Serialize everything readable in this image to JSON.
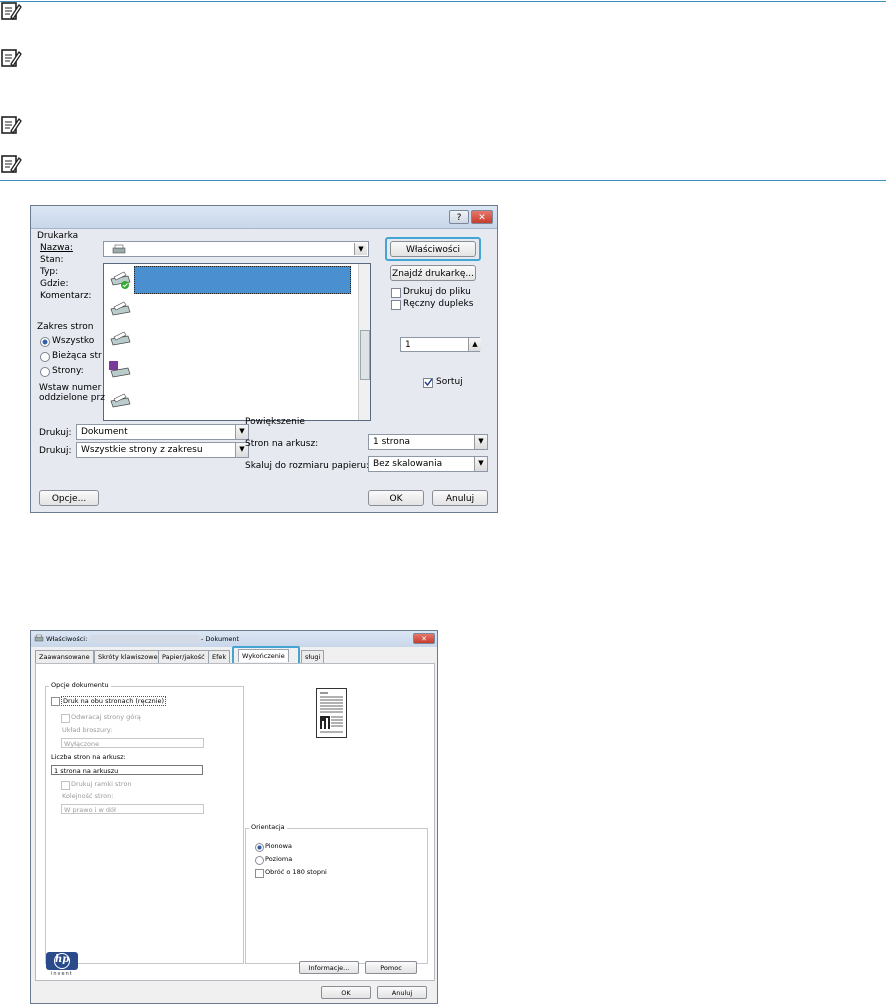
{
  "notes": {
    "count": 4
  },
  "print_dialog": {
    "help_glyph": "?",
    "close_glyph": "✕",
    "printer_group": "Drukarka",
    "name_label": "Nazwa:",
    "status_label": "Stan:",
    "type_label": "Typ:",
    "where_label": "Gdzie:",
    "comment_label": "Komentarz:",
    "properties_button": "Właściwości",
    "find_printer_button": "Znajdź drukarkę...",
    "print_to_file": "Drukuj do pliku",
    "manual_duplex": "Ręczny dupleks",
    "range_group": "Zakres stron",
    "range_all": "Wszystko",
    "range_current": "Bieżąca str",
    "range_pages": "Strony:",
    "insert_hint_1": "Wstaw numer",
    "insert_hint_2": "oddzielone prz",
    "copies_value": "1",
    "collate": "Sortuj",
    "zoom_group": "Powiększenie",
    "print_what_label": "Drukuj:",
    "print_what_value": "Dokument",
    "print_label": "Drukuj:",
    "print_value": "Wszystkie strony z zakresu",
    "pages_per_sheet_label": "Stron na arkusz:",
    "pages_per_sheet_value": "1 strona",
    "scale_label": "Skaluj do rozmiaru papieru:",
    "scale_value": "Bez skalowania",
    "options_button": "Opcje...",
    "ok_button": "OK",
    "cancel_button": "Anuluj",
    "dropdown_arrow": "▼",
    "spin_arrow": "▲"
  },
  "props_dialog": {
    "title_prefix": "Właściwości:",
    "title_suffix": "- Dokument",
    "tabs": [
      "Zaawansowane",
      "Skróty klawiszowe",
      "Papier/jakość",
      "Efek",
      "Wykończenie",
      "sługi"
    ],
    "doc_options": "Opcje dokumentu",
    "duplex_manual": "Druk na obu stronach (ręcznie)",
    "flip_pages_up": "Odwracaj strony górą",
    "booklet_layout": "Układ broszury:",
    "booklet_value": "Wyłączone",
    "pages_per_sheet": "Liczba stron na arkusz:",
    "pages_per_sheet_value": "1 strona na arkuszu",
    "print_borders": "Drukuj ramki stron",
    "page_order": "Kolejność stron:",
    "page_order_value": "W prawo i w dół",
    "orientation": "Orientacja",
    "portrait": "Pionowa",
    "landscape": "Pozioma",
    "rotate_180": "Obróć o 180 stopni",
    "logo_text": "hp",
    "logo_sub": "invent",
    "info_button": "Informacje...",
    "help_button": "Pomoc",
    "ok_button": "OK",
    "cancel_button": "Anuluj"
  },
  "colors": {
    "accent": "#3a8fc0",
    "selection": "#4a90d0",
    "callout": "#45a5d2"
  }
}
